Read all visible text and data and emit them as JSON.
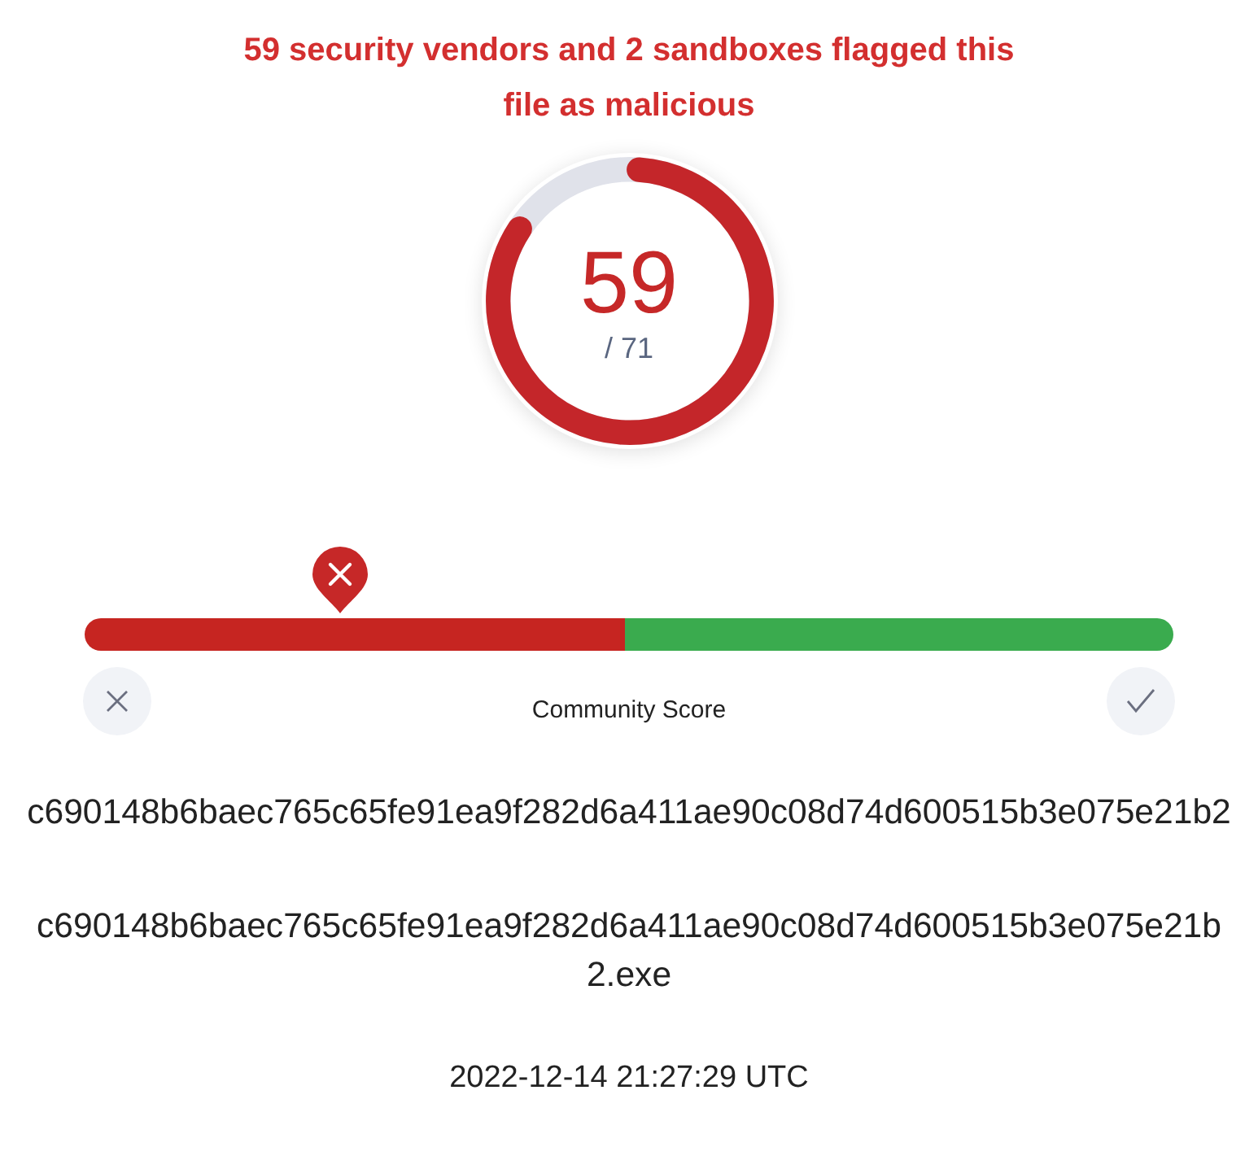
{
  "headline": "59 security vendors and 2 sandboxes flagged this file as malicious",
  "detections": {
    "count": "59",
    "total": "/ 71"
  },
  "community_score": {
    "label": "Community Score",
    "level": 0.235
  },
  "hash": "c690148b6baec765c65fe91ea9f282d6a411ae90c08d74d600515b3e075e21b2",
  "file_name": "c690148b6baec765c65fe91ea9f282d6a411ae90c08d74d600515b3e075e21b2.exe",
  "last_analysis": "2022-12-14 21:27:29 UTC"
}
